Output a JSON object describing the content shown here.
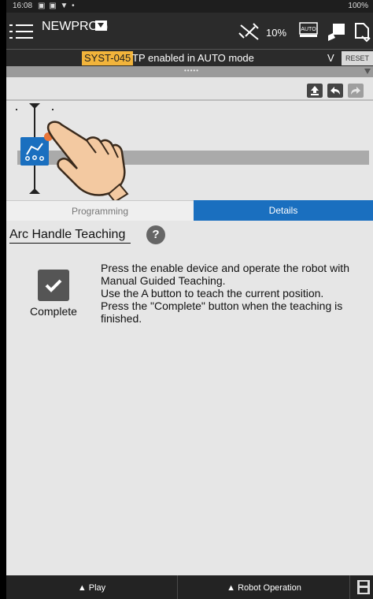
{
  "status_bar": {
    "time": "16:08",
    "icons_left": "▣ ▣ ▼ •",
    "right_text": "100%"
  },
  "top_bar": {
    "program_name": "NEWPROG",
    "speed": "10%",
    "icons": [
      "menu-icon",
      "speed-override-icon",
      "auto-mode-icon",
      "teach-pendant-icon",
      "page-icon"
    ]
  },
  "alarm": {
    "code": "SYST-045",
    "message": "TP enabled in AUTO mode",
    "expand_label": "V",
    "reset_label": "RESET",
    "code_color": "#f2b43b"
  },
  "grip": {
    "dots": "•••••"
  },
  "toolbar": {
    "icons": [
      "upload-icon",
      "undo-icon",
      "redo-icon"
    ]
  },
  "tabs": {
    "programming": "Programming",
    "details": "Details",
    "active": "Details",
    "active_color": "#1a6fbf"
  },
  "details": {
    "title": "Arc Handle Teaching",
    "help_label": "?",
    "complete_label": "Complete",
    "instructions": [
      "Press the enable device and operate the robot with",
      "Manual Guided Teaching.",
      "Use the A button to teach the current position.",
      "Press the \"Complete\" button when the teaching is",
      "finished."
    ]
  },
  "bottom_bar": {
    "play_label": "▲ Play",
    "robot_operation_label": "▲ Robot Operation"
  }
}
